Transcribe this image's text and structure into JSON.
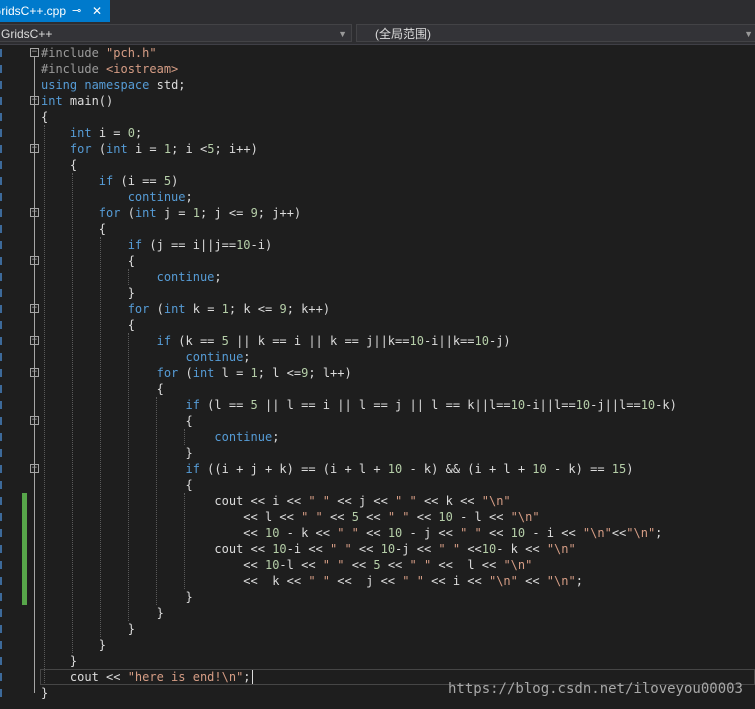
{
  "tab": {
    "title": "GridsC++.cpp",
    "pin_icon": "pin-icon",
    "close_icon": "close-icon"
  },
  "navbar": {
    "project": "GridsC++",
    "scope": "(全局范围)"
  },
  "folded_lines": [
    0,
    3,
    6,
    10,
    13,
    16,
    18,
    20,
    23,
    26
  ],
  "changed_lines": [
    28,
    35
  ],
  "lines": [
    [
      [
        "pp",
        "#include "
      ],
      [
        "str",
        "\"pch.h\""
      ]
    ],
    [
      [
        "pp",
        "#include "
      ],
      [
        "str",
        "<iostream>"
      ]
    ],
    [
      [
        "kw",
        "using"
      ],
      [
        "pl",
        " "
      ],
      [
        "kw",
        "namespace"
      ],
      [
        "pl",
        " std;"
      ]
    ],
    [
      [
        "kw",
        "int"
      ],
      [
        "pl",
        " main()"
      ]
    ],
    [
      [
        "pl",
        "{"
      ]
    ],
    [
      [
        "pl",
        "    "
      ],
      [
        "kw",
        "int"
      ],
      [
        "pl",
        " i = "
      ],
      [
        "num",
        "0"
      ],
      [
        "pl",
        ";"
      ]
    ],
    [
      [
        "pl",
        "    "
      ],
      [
        "kw",
        "for"
      ],
      [
        "pl",
        " ("
      ],
      [
        "kw",
        "int"
      ],
      [
        "pl",
        " i = "
      ],
      [
        "num",
        "1"
      ],
      [
        "pl",
        "; i <"
      ],
      [
        "num",
        "5"
      ],
      [
        "pl",
        "; i++)"
      ]
    ],
    [
      [
        "pl",
        "    {"
      ]
    ],
    [
      [
        "pl",
        "        "
      ],
      [
        "kw",
        "if"
      ],
      [
        "pl",
        " (i == "
      ],
      [
        "num",
        "5"
      ],
      [
        "pl",
        ")"
      ]
    ],
    [
      [
        "pl",
        "            "
      ],
      [
        "kw",
        "continue"
      ],
      [
        "pl",
        ";"
      ]
    ],
    [
      [
        "pl",
        "        "
      ],
      [
        "kw",
        "for"
      ],
      [
        "pl",
        " ("
      ],
      [
        "kw",
        "int"
      ],
      [
        "pl",
        " j = "
      ],
      [
        "num",
        "1"
      ],
      [
        "pl",
        "; j <= "
      ],
      [
        "num",
        "9"
      ],
      [
        "pl",
        "; j++)"
      ]
    ],
    [
      [
        "pl",
        "        {"
      ]
    ],
    [
      [
        "pl",
        "            "
      ],
      [
        "kw",
        "if"
      ],
      [
        "pl",
        " (j == i||j=="
      ],
      [
        "num",
        "10"
      ],
      [
        "pl",
        "-i)"
      ]
    ],
    [
      [
        "pl",
        "            {"
      ]
    ],
    [
      [
        "pl",
        "                "
      ],
      [
        "kw",
        "continue"
      ],
      [
        "pl",
        ";"
      ]
    ],
    [
      [
        "pl",
        "            }"
      ]
    ],
    [
      [
        "pl",
        "            "
      ],
      [
        "kw",
        "for"
      ],
      [
        "pl",
        " ("
      ],
      [
        "kw",
        "int"
      ],
      [
        "pl",
        " k = "
      ],
      [
        "num",
        "1"
      ],
      [
        "pl",
        "; k <= "
      ],
      [
        "num",
        "9"
      ],
      [
        "pl",
        "; k++)"
      ]
    ],
    [
      [
        "pl",
        "            {"
      ]
    ],
    [
      [
        "pl",
        "                "
      ],
      [
        "kw",
        "if"
      ],
      [
        "pl",
        " (k == "
      ],
      [
        "num",
        "5"
      ],
      [
        "pl",
        " || k == i || k == j||k=="
      ],
      [
        "num",
        "10"
      ],
      [
        "pl",
        "-i||k=="
      ],
      [
        "num",
        "10"
      ],
      [
        "pl",
        "-j)"
      ]
    ],
    [
      [
        "pl",
        "                    "
      ],
      [
        "kw",
        "continue"
      ],
      [
        "pl",
        ";"
      ]
    ],
    [
      [
        "pl",
        "                "
      ],
      [
        "kw",
        "for"
      ],
      [
        "pl",
        " ("
      ],
      [
        "kw",
        "int"
      ],
      [
        "pl",
        " l = "
      ],
      [
        "num",
        "1"
      ],
      [
        "pl",
        "; l <="
      ],
      [
        "num",
        "9"
      ],
      [
        "pl",
        "; l++)"
      ]
    ],
    [
      [
        "pl",
        "                {"
      ]
    ],
    [
      [
        "pl",
        "                    "
      ],
      [
        "kw",
        "if"
      ],
      [
        "pl",
        " (l == "
      ],
      [
        "num",
        "5"
      ],
      [
        "pl",
        " || l == i || l == j || l == k||l=="
      ],
      [
        "num",
        "10"
      ],
      [
        "pl",
        "-i||l=="
      ],
      [
        "num",
        "10"
      ],
      [
        "pl",
        "-j||l=="
      ],
      [
        "num",
        "10"
      ],
      [
        "pl",
        "-k)"
      ]
    ],
    [
      [
        "pl",
        "                    {"
      ]
    ],
    [
      [
        "pl",
        "                        "
      ],
      [
        "kw",
        "continue"
      ],
      [
        "pl",
        ";"
      ]
    ],
    [
      [
        "pl",
        "                    }"
      ]
    ],
    [
      [
        "pl",
        "                    "
      ],
      [
        "kw",
        "if"
      ],
      [
        "pl",
        " ((i + j + k) == (i + l + "
      ],
      [
        "num",
        "10"
      ],
      [
        "pl",
        " - k) && (i + l + "
      ],
      [
        "num",
        "10"
      ],
      [
        "pl",
        " - k) == "
      ],
      [
        "num",
        "15"
      ],
      [
        "pl",
        ")"
      ]
    ],
    [
      [
        "pl",
        "                    {"
      ]
    ],
    [
      [
        "pl",
        "                        cout << i << "
      ],
      [
        "str",
        "\" \""
      ],
      [
        "pl",
        " << j << "
      ],
      [
        "str",
        "\" \""
      ],
      [
        "pl",
        " << k << "
      ],
      [
        "str",
        "\"\\n\""
      ]
    ],
    [
      [
        "pl",
        "                            << l << "
      ],
      [
        "str",
        "\" \""
      ],
      [
        "pl",
        " << "
      ],
      [
        "num",
        "5"
      ],
      [
        "pl",
        " << "
      ],
      [
        "str",
        "\" \""
      ],
      [
        "pl",
        " << "
      ],
      [
        "num",
        "10"
      ],
      [
        "pl",
        " - l << "
      ],
      [
        "str",
        "\"\\n\""
      ]
    ],
    [
      [
        "pl",
        "                            << "
      ],
      [
        "num",
        "10"
      ],
      [
        "pl",
        " - k << "
      ],
      [
        "str",
        "\" \""
      ],
      [
        "pl",
        " << "
      ],
      [
        "num",
        "10"
      ],
      [
        "pl",
        " - j << "
      ],
      [
        "str",
        "\" \""
      ],
      [
        "pl",
        " << "
      ],
      [
        "num",
        "10"
      ],
      [
        "pl",
        " - i << "
      ],
      [
        "str",
        "\"\\n\""
      ],
      [
        "pl",
        "<<"
      ],
      [
        "str",
        "\"\\n\""
      ],
      [
        "pl",
        ";"
      ]
    ],
    [
      [
        "pl",
        "                        cout << "
      ],
      [
        "num",
        "10"
      ],
      [
        "pl",
        "-i << "
      ],
      [
        "str",
        "\" \""
      ],
      [
        "pl",
        " << "
      ],
      [
        "num",
        "10"
      ],
      [
        "pl",
        "-j << "
      ],
      [
        "str",
        "\" \""
      ],
      [
        "pl",
        " <<"
      ],
      [
        "num",
        "10"
      ],
      [
        "pl",
        "- k << "
      ],
      [
        "str",
        "\"\\n\""
      ]
    ],
    [
      [
        "pl",
        "                            << "
      ],
      [
        "num",
        "10"
      ],
      [
        "pl",
        "-l << "
      ],
      [
        "str",
        "\" \""
      ],
      [
        "pl",
        " << "
      ],
      [
        "num",
        "5"
      ],
      [
        "pl",
        " << "
      ],
      [
        "str",
        "\" \""
      ],
      [
        "pl",
        " <<  l << "
      ],
      [
        "str",
        "\"\\n\""
      ]
    ],
    [
      [
        "pl",
        "                            <<  k << "
      ],
      [
        "str",
        "\" \""
      ],
      [
        "pl",
        " <<  j << "
      ],
      [
        "str",
        "\" \""
      ],
      [
        "pl",
        " << i << "
      ],
      [
        "str",
        "\"\\n\""
      ],
      [
        "pl",
        " << "
      ],
      [
        "str",
        "\"\\n\""
      ],
      [
        "pl",
        ";"
      ]
    ],
    [
      [
        "pl",
        "                    }"
      ]
    ],
    [
      [
        "pl",
        "                }"
      ]
    ],
    [
      [
        "pl",
        "            }"
      ]
    ],
    [
      [
        "pl",
        "        }"
      ]
    ],
    [
      [
        "pl",
        "    }"
      ]
    ],
    [
      [
        "pl",
        "    cout << "
      ],
      [
        "str",
        "\"here is end!\\n\""
      ],
      [
        "pl",
        ";"
      ]
    ],
    [
      [
        "pl",
        "}"
      ]
    ]
  ],
  "watermark": "https://blog.csdn.net/iloveyou00003"
}
